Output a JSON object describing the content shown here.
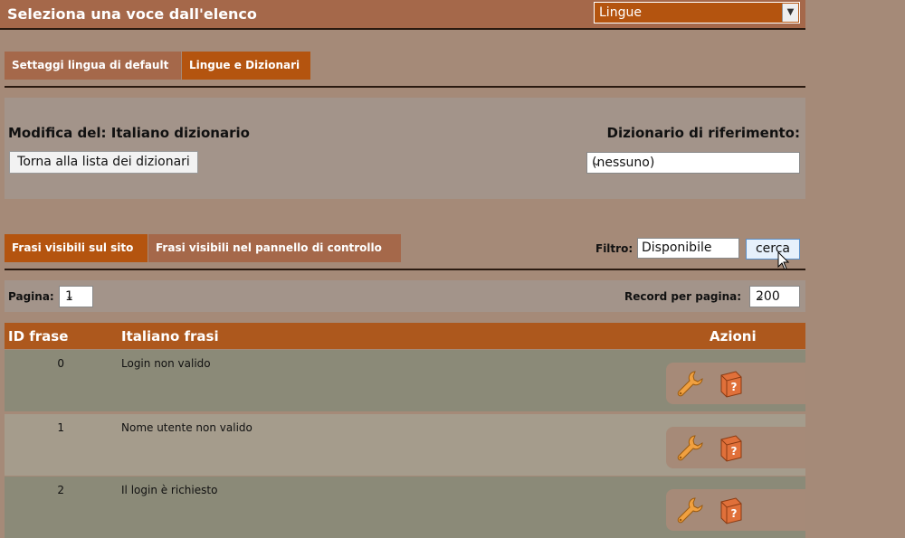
{
  "header": {
    "title": "Seleziona una voce dall'elenco",
    "section_select_value": "Lingue"
  },
  "tabs_top": [
    {
      "label": "Settaggi lingua di default",
      "active": false
    },
    {
      "label": "Lingue e Dizionari",
      "active": true
    }
  ],
  "editor": {
    "title": "Modifica del: Italiano dizionario",
    "back_button": "Torna alla lista dei dizionari",
    "reference_label": "Dizionario di riferimento:",
    "reference_value": "(nessuno)"
  },
  "tabs_phrases": [
    {
      "label": "Frasi visibili sul sito",
      "active": true
    },
    {
      "label": "Frasi visibili nel pannello di controllo",
      "active": false
    }
  ],
  "filter": {
    "label": "Filtro:",
    "value": "Disponibile",
    "button": "cerca"
  },
  "pager": {
    "page_label": "Pagina:",
    "page_value": "1",
    "records_label": "Record per pagina:",
    "records_value": "200"
  },
  "table": {
    "headers": [
      "ID frase",
      "Italiano frasi",
      "Azioni"
    ],
    "rows": [
      {
        "id": "0",
        "text": "Login non valido"
      },
      {
        "id": "1",
        "text": "Nome utente non valido"
      },
      {
        "id": "2",
        "text": "Il login è richiesto"
      }
    ]
  },
  "icons": {
    "edit": "wrench-icon",
    "help": "help-book-icon",
    "dropdown": "chevron-down-icon",
    "cursor": "mouse-pointer-icon"
  },
  "colors": {
    "background": "#a58a78",
    "accent": "#b4540f",
    "tab_inactive": "#a5684a",
    "panel": "#a3948a",
    "row_dark": "#8b8a78",
    "row_light": "#a59c8c"
  }
}
